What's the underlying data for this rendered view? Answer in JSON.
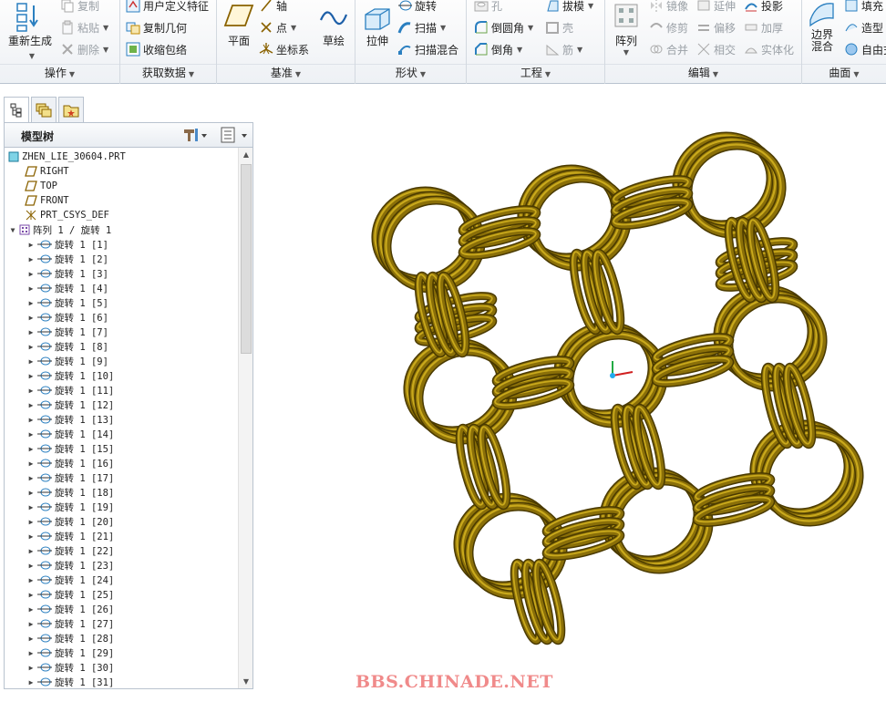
{
  "ribbon": {
    "groups": {
      "operations": {
        "name": "操作",
        "regen": "重新生成",
        "copy": "复制",
        "paste": "粘贴",
        "delete": "删除"
      },
      "get_data": {
        "name": "获取数据",
        "udf": "用户定义特征",
        "copy_geom": "复制几何",
        "shrinkwrap": "收缩包络"
      },
      "datum": {
        "name": "基准",
        "plane": "平面",
        "axis": "轴",
        "point": "点",
        "csys": "坐标系",
        "sketch": "草绘"
      },
      "shapes": {
        "name": "形状",
        "extrude": "拉伸",
        "revolve": "旋转",
        "sweep": "扫描",
        "swept_blend": "扫描混合"
      },
      "engineering": {
        "name": "工程",
        "hole": "孔",
        "draft": "拔模",
        "round": "倒圆角",
        "shell": "壳",
        "chamfer": "倒角",
        "rib": "筋"
      },
      "editing": {
        "name": "编辑",
        "pattern": "阵列",
        "mirror": "镜像",
        "extend": "延伸",
        "project": "投影",
        "trim": "修剪",
        "offset": "偏移",
        "thicken": "加厚",
        "merge": "合并",
        "intersect": "相交",
        "solidify": "实体化"
      },
      "surfaces": {
        "name": "曲面",
        "boundary_blend": "边界混合",
        "fill": "填充",
        "style": "造型",
        "freestyle": "自由式"
      }
    }
  },
  "tree": {
    "title": "模型树",
    "root": "ZHEN_LIE_30604.PRT",
    "datums": [
      "RIGHT",
      "TOP",
      "FRONT",
      "PRT_CSYS_DEF"
    ],
    "pattern": "阵列 1 / 旋转 1",
    "features": [
      "旋转 1 [1]",
      "旋转 1 [2]",
      "旋转 1 [3]",
      "旋转 1 [4]",
      "旋转 1 [5]",
      "旋转 1 [6]",
      "旋转 1 [7]",
      "旋转 1 [8]",
      "旋转 1 [9]",
      "旋转 1 [10]",
      "旋转 1 [11]",
      "旋转 1 [12]",
      "旋转 1 [13]",
      "旋转 1 [14]",
      "旋转 1 [15]",
      "旋转 1 [16]",
      "旋转 1 [17]",
      "旋转 1 [18]",
      "旋转 1 [19]",
      "旋转 1 [20]",
      "旋转 1 [21]",
      "旋转 1 [22]",
      "旋转 1 [23]",
      "旋转 1 [24]",
      "旋转 1 [25]",
      "旋转 1 [26]",
      "旋转 1 [27]",
      "旋转 1 [28]",
      "旋转 1 [29]",
      "旋转 1 [30]",
      "旋转 1 [31]"
    ]
  },
  "watermark": "BBS.CHINADE.NET",
  "colors": {
    "ring": "#8a6f08",
    "ring_light": "#c9a91c",
    "ring_dark": "#4a3a00",
    "accent": "#2a7fc0"
  }
}
